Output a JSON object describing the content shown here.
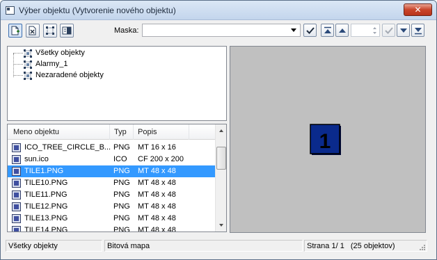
{
  "window": {
    "title": "Výber objektu (Vytvorenie nového objektu)",
    "close_label": "✕"
  },
  "toolbar": {
    "mask_label": "Maska:",
    "mask_value": ""
  },
  "tree": {
    "items": [
      {
        "label": "Všetky objekty"
      },
      {
        "label": "Alarmy_1"
      },
      {
        "label": "Nezaradené objekty"
      }
    ]
  },
  "list": {
    "columns": [
      "Meno objektu",
      "Typ",
      "Popis"
    ],
    "rows": [
      {
        "name": "ICO_TREE_CIRCLE_B...",
        "type": "PNG",
        "desc": "MT 16 x  16",
        "selected": false
      },
      {
        "name": "sun.ico",
        "type": "ICO",
        "desc": "CF 200 x  200",
        "selected": false
      },
      {
        "name": "TILE1.PNG",
        "type": "PNG",
        "desc": "MT 48 x  48",
        "selected": true
      },
      {
        "name": "TILE10.PNG",
        "type": "PNG",
        "desc": "MT 48 x  48",
        "selected": false
      },
      {
        "name": "TILE11.PNG",
        "type": "PNG",
        "desc": "MT 48 x  48",
        "selected": false
      },
      {
        "name": "TILE12.PNG",
        "type": "PNG",
        "desc": "MT 48 x  48",
        "selected": false
      },
      {
        "name": "TILE13.PNG",
        "type": "PNG",
        "desc": "MT 48 x  48",
        "selected": false
      },
      {
        "name": "TILE14.PNG",
        "type": "PNG",
        "desc": "MT 48 x  48",
        "selected": false
      }
    ]
  },
  "preview": {
    "tile_number": "1",
    "tile_color": "#0a2a8c"
  },
  "status": {
    "filter": "Všetky objekty",
    "kind": "Bitová mapa",
    "page": "Strana  1/ 1",
    "count": "(25 objektov)"
  },
  "colors": {
    "selection": "#3399ff",
    "preview_bg": "#c0c0c0"
  }
}
